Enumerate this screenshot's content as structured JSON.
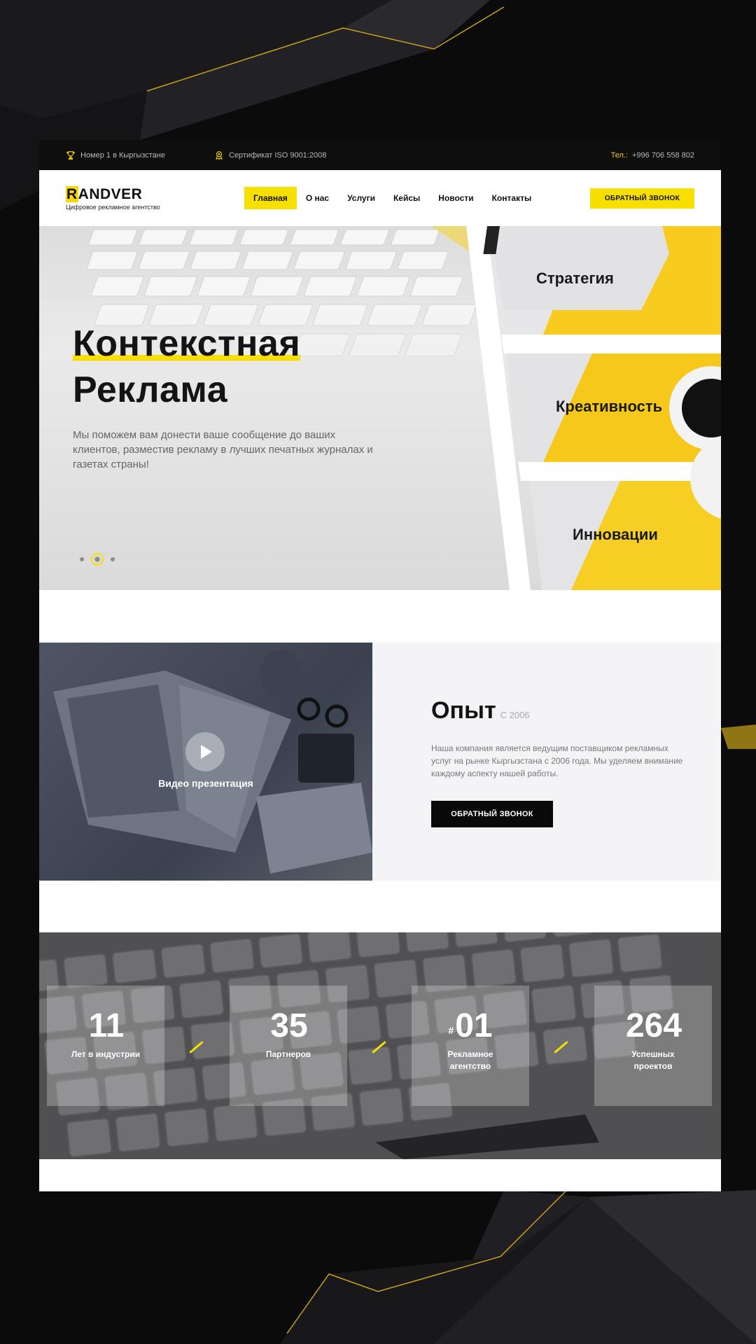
{
  "topbar": {
    "items": [
      {
        "icon": "trophy-icon",
        "text": "Номер 1 в Кыргызстане"
      },
      {
        "icon": "award-icon",
        "text": "Сертификат ISO 9001:2008"
      }
    ],
    "phone_label": "Тел.:",
    "phone": "+996 706 558 802"
  },
  "header": {
    "logo_first": "R",
    "logo_rest": "ANDVER",
    "logo_tagline": "Цифровое рекламное агентство",
    "nav": [
      "Главная",
      "О нас",
      "Услуги",
      "Кейсы",
      "Новости",
      "Контакты"
    ],
    "active_nav": "Главная",
    "cta": "ОБРАТНЫЙ ЗВОНОК"
  },
  "hero": {
    "title_line1": "Контекстная",
    "title_line2": "Реклама",
    "text": "Мы поможем вам донести ваше сообщение до ваших клиентов, разместив рекламу в лучших печатных журналах и газетах страны!",
    "slides_count": 3,
    "active_slide": 2,
    "panels": [
      "Стратегия",
      "Креативность",
      "Инновации"
    ]
  },
  "experience": {
    "video_label": "Видео презентация",
    "title": "Опыт",
    "since": "С 2006",
    "text": "Наша компания является ведущим поставщиком рекламных услуг на рынке Кыргызстана с 2006 года. Мы уделяем внимание каждому аспекту нашей работы.",
    "button": "ОБРАТНЫЙ ЗВОНОК"
  },
  "stats": [
    {
      "prefix": "",
      "value": "11",
      "label": "Лет в индустрии"
    },
    {
      "prefix": "",
      "value": "35",
      "label": "Партнеров"
    },
    {
      "prefix": "#",
      "value": "01",
      "label": "Рекламное агентство"
    },
    {
      "prefix": "",
      "value": "264",
      "label": "Успешных проектов"
    }
  ],
  "colors": {
    "accent": "#f7e000",
    "dark": "#0b0b0c"
  }
}
